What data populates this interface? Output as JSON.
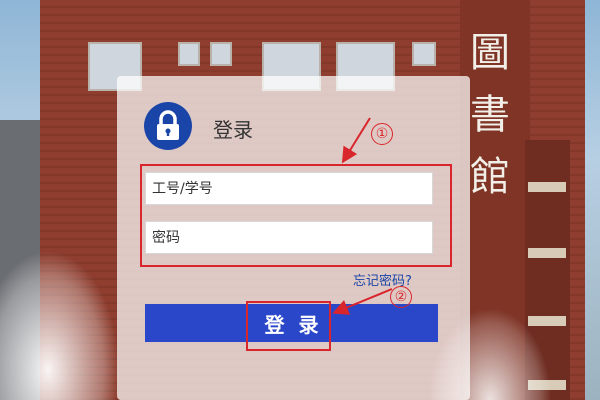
{
  "background": {
    "building_sign": "圖書館"
  },
  "login": {
    "title": "登录",
    "username_placeholder": "工号/学号",
    "password_placeholder": "密码",
    "forgot_password": "忘记密码?",
    "submit_label": "登录"
  },
  "annotations": {
    "marker_1": "①",
    "marker_2": "②"
  },
  "colors": {
    "accent": "#2a46c9",
    "lock_icon_bg": "#1a45a8",
    "annotation": "#d9262c"
  }
}
